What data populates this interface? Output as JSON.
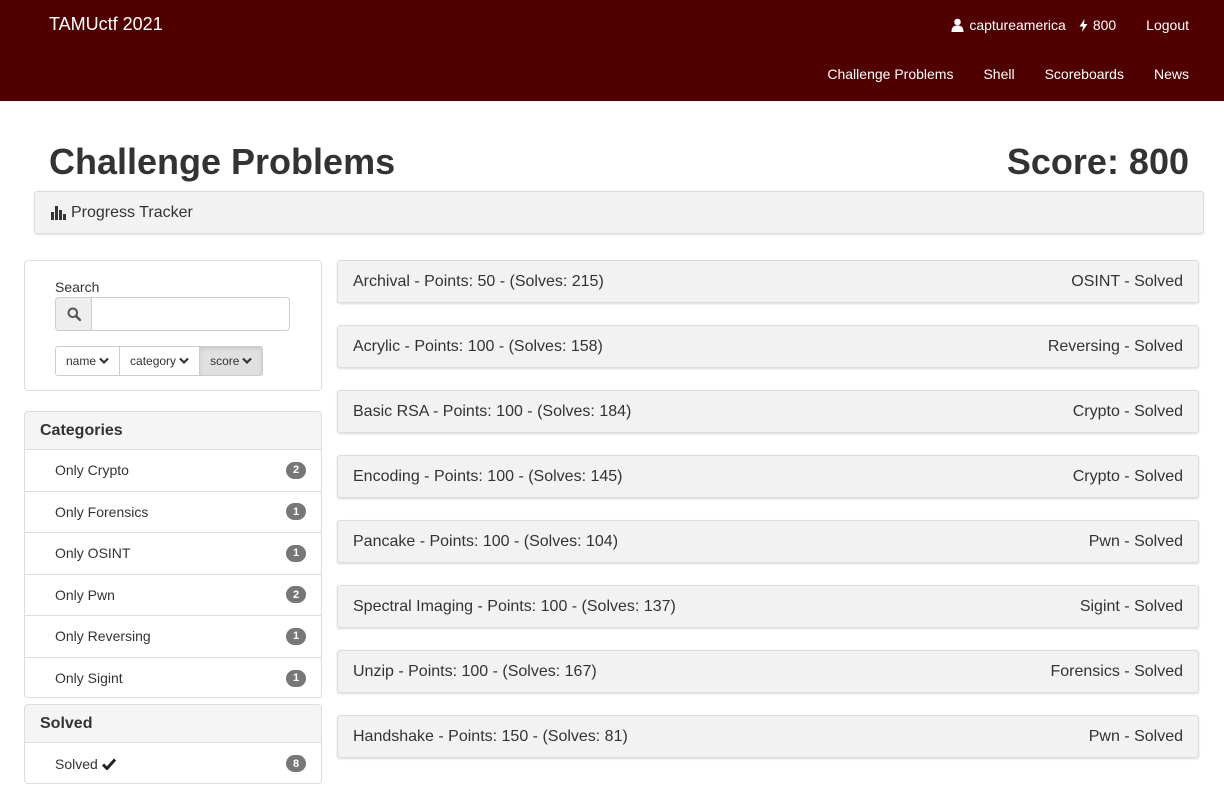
{
  "navbar": {
    "brand": "TAMUctf 2021",
    "username": "captureamerica",
    "score": "800",
    "logout": "Logout",
    "links": [
      "Challenge Problems",
      "Shell",
      "Scoreboards",
      "News"
    ],
    "background": "#500000"
  },
  "header": {
    "title": "Challenge Problems",
    "score": "Score: 800"
  },
  "progress_tracker": {
    "label": "Progress Tracker",
    "icon": "bar-chart-icon"
  },
  "search": {
    "label": "Search",
    "value": "",
    "placeholder": "",
    "sort_buttons": [
      "name",
      "category",
      "score"
    ],
    "active_sort": "score"
  },
  "categories": {
    "heading": "Categories",
    "items": [
      {
        "label": "Only Crypto",
        "count": "2"
      },
      {
        "label": "Only Forensics",
        "count": "1"
      },
      {
        "label": "Only OSINT",
        "count": "1"
      },
      {
        "label": "Only Pwn",
        "count": "2"
      },
      {
        "label": "Only Reversing",
        "count": "1"
      },
      {
        "label": "Only Sigint",
        "count": "1"
      }
    ]
  },
  "solved": {
    "heading": "Solved",
    "items": [
      {
        "label": "Solved",
        "count": "8",
        "icon": "checkmark-icon"
      }
    ]
  },
  "problems": [
    {
      "title": "Archival - Points: 50 - (Solves: 215)",
      "status": "OSINT - Solved"
    },
    {
      "title": "Acrylic - Points: 100 - (Solves: 158)",
      "status": "Reversing - Solved"
    },
    {
      "title": "Basic RSA - Points: 100 - (Solves: 184)",
      "status": "Crypto - Solved"
    },
    {
      "title": "Encoding - Points: 100 - (Solves: 145)",
      "status": "Crypto - Solved"
    },
    {
      "title": "Pancake - Points: 100 - (Solves: 104)",
      "status": "Pwn - Solved"
    },
    {
      "title": "Spectral Imaging - Points: 100 - (Solves: 137)",
      "status": "Sigint - Solved"
    },
    {
      "title": "Unzip - Points: 100 - (Solves: 167)",
      "status": "Forensics - Solved"
    },
    {
      "title": "Handshake - Points: 150 - (Solves: 81)",
      "status": "Pwn - Solved"
    }
  ]
}
